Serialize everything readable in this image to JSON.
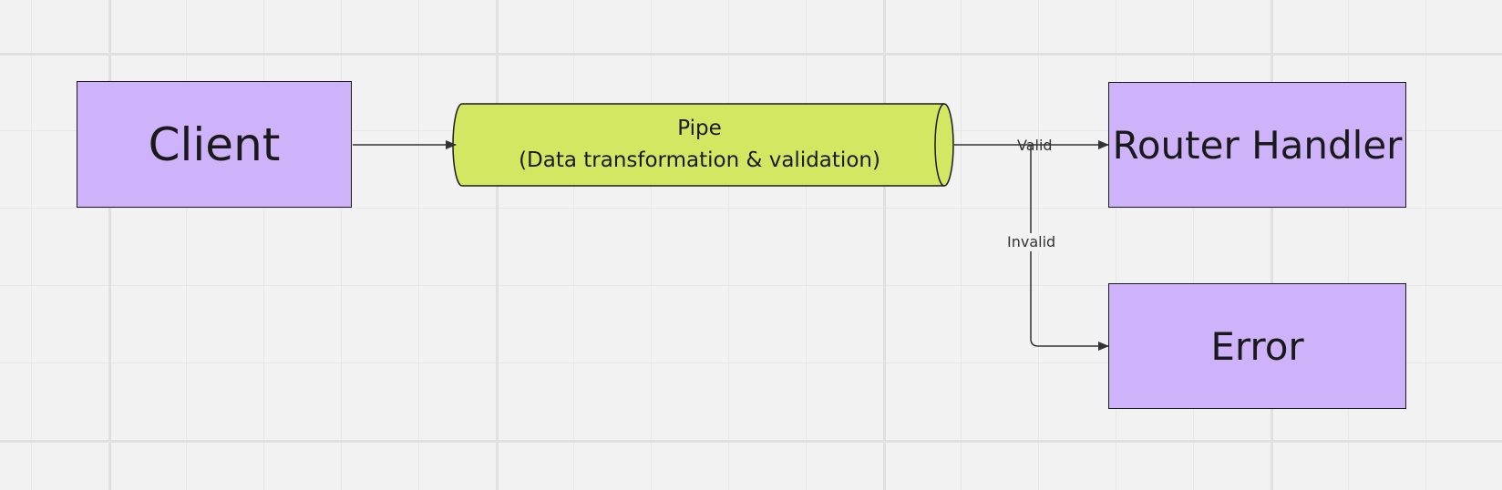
{
  "diagram": {
    "nodes": {
      "client": {
        "label": "Client"
      },
      "pipe": {
        "title": "Pipe",
        "subtitle": "(Data transformation & validation)"
      },
      "router_handler": {
        "label": "Router Handler"
      },
      "error": {
        "label": "Error"
      }
    },
    "edges": {
      "client_to_pipe": {
        "from": "Client",
        "to": "Pipe"
      },
      "pipe_to_router": {
        "from": "Pipe",
        "to": "Router Handler",
        "label": "Valid"
      },
      "pipe_to_error": {
        "from": "Pipe",
        "to": "Error",
        "label": "Invalid"
      }
    }
  },
  "colors": {
    "process_fill": "#ceb2fa",
    "pipe_fill": "#d3e763",
    "stroke": "#1a1a1a",
    "canvas": "#f2f2f2"
  }
}
